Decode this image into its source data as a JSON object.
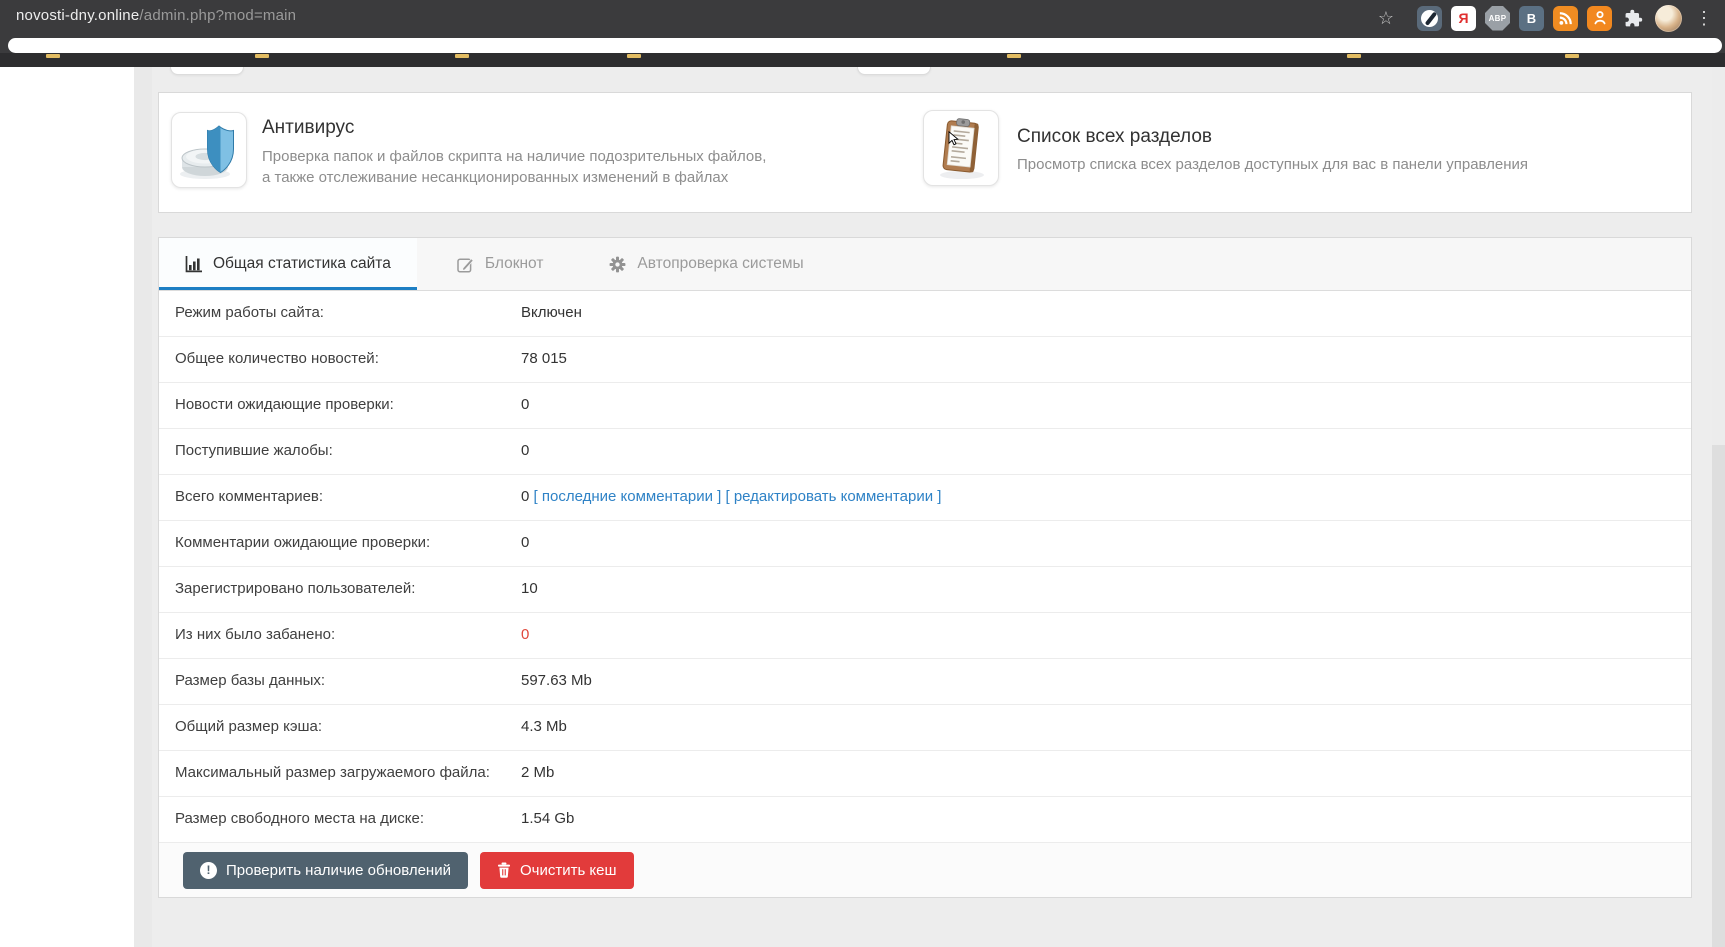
{
  "browser": {
    "url_host": "novosti-dny.online",
    "url_path": "/admin.php?mod=main",
    "ext_yandex_letter": "Я",
    "ext_abp_label": "ABP",
    "ext_vk_letter": "B",
    "menu_dots": "⋮",
    "star": "☆"
  },
  "cards": [
    {
      "title": "Антивирус",
      "description": "Проверка папок и файлов скрипта на наличие подозрительных файлов, а также отслеживание несанкционированных изменений в файлах"
    },
    {
      "title": "Список всех разделов",
      "description": "Просмотр списка всех разделов доступных для вас в панели управления"
    }
  ],
  "tabs": [
    {
      "label": "Общая статистика сайта",
      "icon": "bar-chart-icon",
      "active": true
    },
    {
      "label": "Блокнот",
      "icon": "edit-icon",
      "active": false
    },
    {
      "label": "Автопроверка системы",
      "icon": "gear-icon",
      "active": false
    }
  ],
  "stats": {
    "rows": [
      {
        "label": "Режим работы сайта:",
        "value": "Включен"
      },
      {
        "label": "Общее количество новостей:",
        "value": "78 015"
      },
      {
        "label": "Новости ожидающие проверки:",
        "value": "0"
      },
      {
        "label": "Поступившие жалобы:",
        "value": "0"
      },
      {
        "label": "Всего комментариев:",
        "value": "0",
        "links": [
          "последние комментарии",
          "редактировать комментарии"
        ]
      },
      {
        "label": "Комментарии ожидающие проверки:",
        "value": "0"
      },
      {
        "label": "Зарегистрировано пользователей:",
        "value": "10"
      },
      {
        "label": "Из них было забанено:",
        "value": "0",
        "danger": true
      },
      {
        "label": "Размер базы данных:",
        "value": "597.63 Mb"
      },
      {
        "label": "Общий размер кэша:",
        "value": "4.3 Mb"
      },
      {
        "label": "Максимальный размер загружаемого файла:",
        "value": "2 Mb"
      },
      {
        "label": "Размер свободного места на диске:",
        "value": "1.54 Gb"
      }
    ]
  },
  "buttons": [
    {
      "label": "Проверить наличие обновлений",
      "icon": "exclamation-circle-icon",
      "icon_char": "!"
    },
    {
      "label": "Очистить кеш",
      "icon": "trash-icon"
    }
  ],
  "colors": {
    "accent_blue": "#1d7fc4",
    "link_blue": "#2e82c6",
    "danger_red": "#e0483c",
    "button_slate": "#50626F",
    "button_red": "#e23b3b"
  }
}
